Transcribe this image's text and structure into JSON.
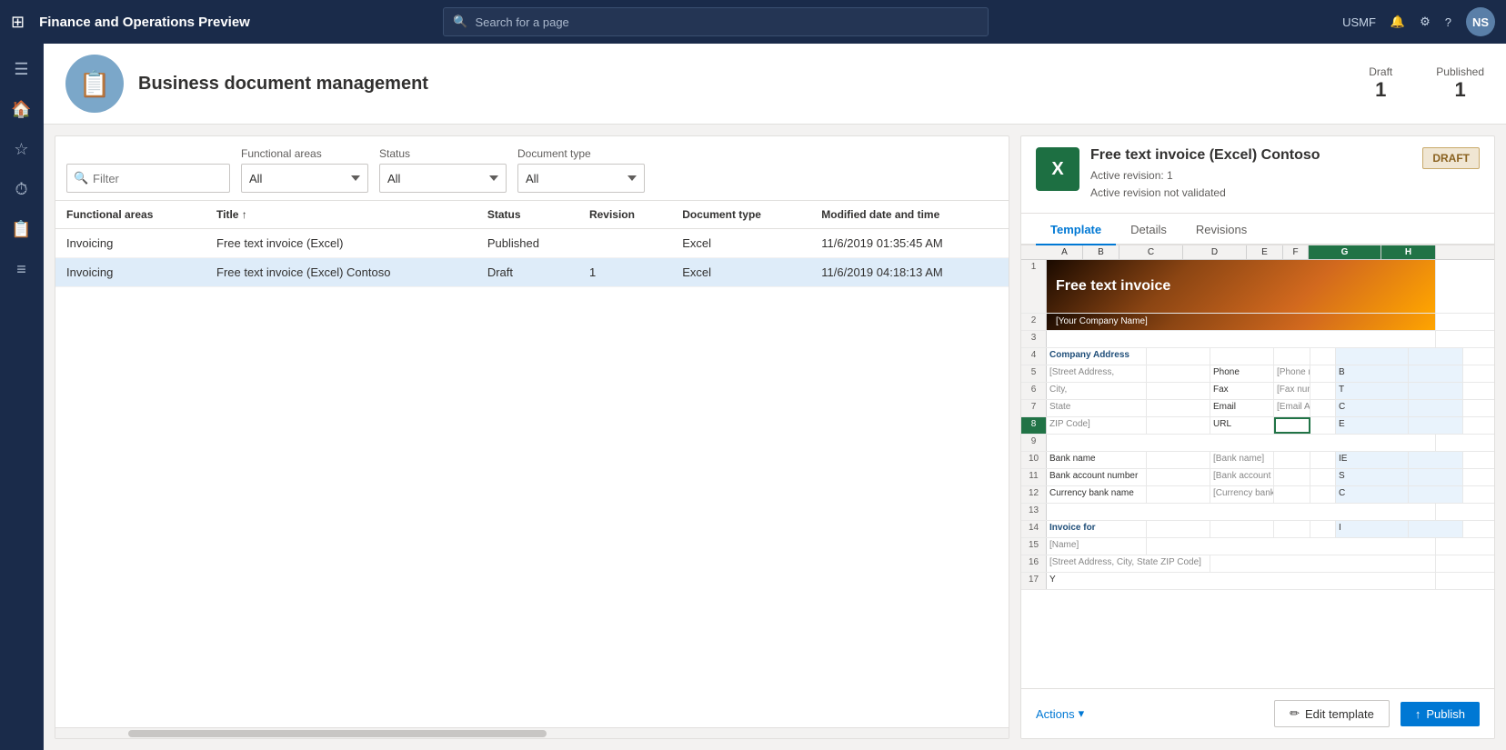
{
  "app": {
    "title": "Finance and Operations Preview",
    "company": "USMF",
    "avatar": "NS",
    "search_placeholder": "Search for a page"
  },
  "page": {
    "title": "Business document management",
    "icon": "📄",
    "draft_count": "1",
    "draft_label": "Draft",
    "published_count": "1",
    "published_label": "Published"
  },
  "filters": {
    "filter_placeholder": "Filter",
    "functional_areas_label": "Functional areas",
    "functional_areas_value": "All",
    "status_label": "Status",
    "status_value": "All",
    "document_type_label": "Document type",
    "document_type_value": "All"
  },
  "table": {
    "columns": [
      "Functional areas",
      "Title",
      "Status",
      "Revision",
      "Document type",
      "Modified date and time"
    ],
    "rows": [
      {
        "functional_areas": "Invoicing",
        "title": "Free text invoice (Excel)",
        "status": "Published",
        "revision": "",
        "document_type": "Excel",
        "modified": "11/6/2019 01:35:45 AM",
        "selected": false
      },
      {
        "functional_areas": "Invoicing",
        "title": "Free text invoice (Excel) Contoso",
        "status": "Draft",
        "revision": "1",
        "document_type": "Excel",
        "modified": "11/6/2019 04:18:13 AM",
        "selected": true
      }
    ]
  },
  "detail": {
    "title": "Free text invoice (Excel) Contoso",
    "active_revision": "Active revision: 1",
    "validation_status": "Active revision not validated",
    "badge": "DRAFT",
    "tabs": [
      "Template",
      "Details",
      "Revisions"
    ],
    "active_tab": "Template"
  },
  "excel_preview": {
    "col_headers": [
      "A",
      "B",
      "C",
      "D",
      "E",
      "F",
      "G",
      "H"
    ],
    "selected_cols": [
      "G",
      "H"
    ],
    "invoice_title": "Free text invoice",
    "company_name": "[Your Company Name]",
    "rows": [
      {
        "num": "1",
        "content": "header_image"
      },
      {
        "num": "2",
        "content": "company_name"
      },
      {
        "num": "3",
        "content": ""
      },
      {
        "num": "4",
        "content": "company_address_header"
      },
      {
        "num": "5",
        "content": "address_row1",
        "label": "[Street Address,",
        "phone_label": "Phone",
        "phone_val": "[Phone number]"
      },
      {
        "num": "6",
        "content": "address_row2",
        "label": "City,",
        "phone_label": "Fax",
        "phone_val": "[Fax number]"
      },
      {
        "num": "7",
        "content": "address_row3",
        "label": "State",
        "phone_label": "Email",
        "phone_val": "[Email Address]"
      },
      {
        "num": "8",
        "content": "address_row4",
        "label": "ZIP Code]",
        "phone_label": "URL",
        "selected": true
      },
      {
        "num": "9",
        "content": ""
      },
      {
        "num": "10",
        "content": "bank_name",
        "label": "Bank name",
        "val": "[Bank name]"
      },
      {
        "num": "11",
        "content": "bank_account",
        "label": "Bank account number",
        "val": "[Bank account number]"
      },
      {
        "num": "12",
        "content": "currency",
        "label": "Currency bank name",
        "val": "[Currency bank name]"
      },
      {
        "num": "13",
        "content": ""
      },
      {
        "num": "14",
        "content": "invoice_for",
        "label": "Invoice for"
      },
      {
        "num": "15",
        "content": "name_row",
        "label": "[Name]"
      },
      {
        "num": "16",
        "content": "address_row",
        "label": "[Street Address, City, State ZIP Code]"
      },
      {
        "num": "17",
        "content": ""
      }
    ]
  },
  "actions": {
    "actions_label": "Actions",
    "edit_template_label": "Edit template",
    "publish_label": "Publish"
  },
  "sidebar_icons": [
    "⊞",
    "🏠",
    "★",
    "⏱",
    "📅",
    "≡"
  ],
  "icons": {
    "search": "🔍",
    "bell": "🔔",
    "gear": "⚙",
    "question": "?",
    "pencil": "✏",
    "upload": "↑",
    "chevron_down": "▾"
  }
}
